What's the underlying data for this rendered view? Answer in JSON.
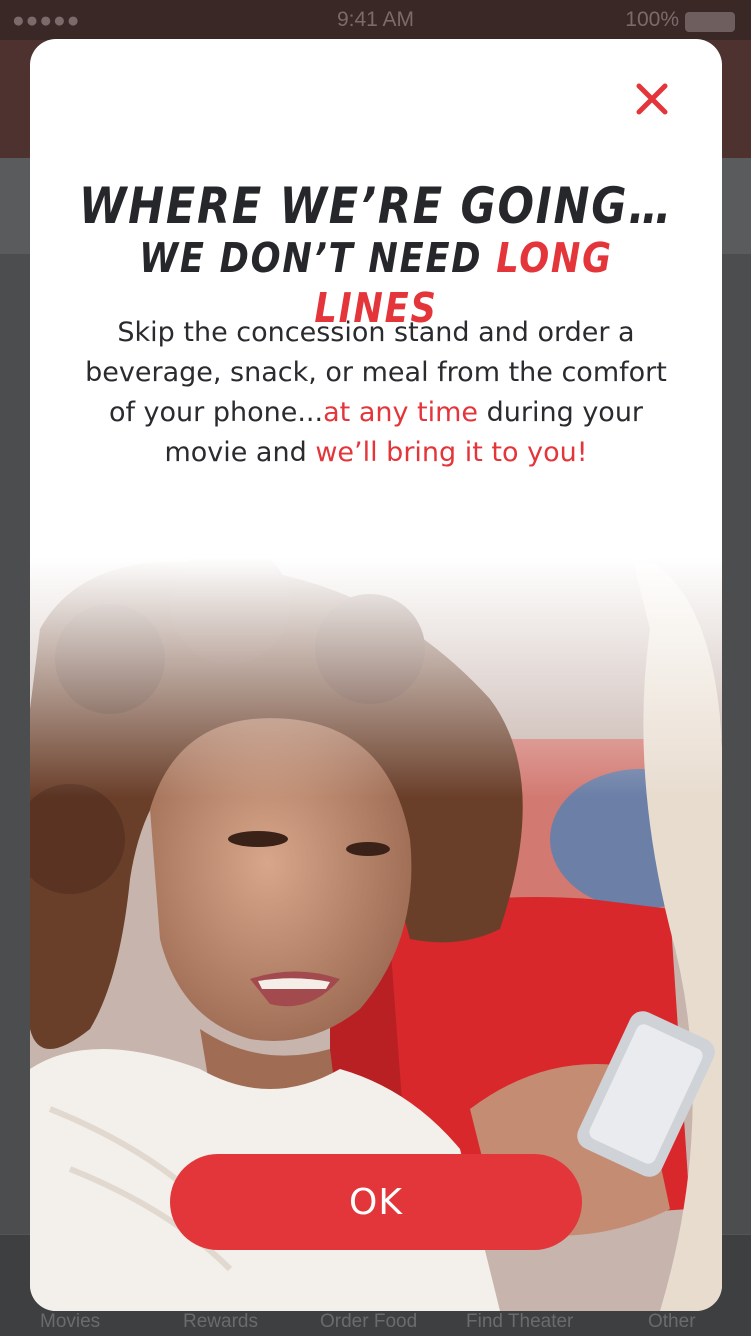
{
  "status_bar": {
    "signal": "●●●●●",
    "time": "9:41 AM",
    "battery": "100%"
  },
  "tab_bar": {
    "items": [
      "Movies",
      "Rewards",
      "Order Food",
      "Find Theater",
      "Other"
    ]
  },
  "modal": {
    "close_icon": "close-icon",
    "headline_line1": "WHERE WE’RE GOING…",
    "headline_line2_prefix": "WE DON’T NEED ",
    "headline_line2_accent": "LONG LINES",
    "body": {
      "part1": "Skip the concession stand and order a beverage, snack, or meal from the comfort of your phone...",
      "accent1": "at any time",
      "part2": " during your movie and ",
      "accent2": "we’ll bring it to you!"
    },
    "ok_label": "OK"
  },
  "colors": {
    "accent": "#e3353a",
    "heading": "#25272b",
    "header_bg": "#4e3230"
  }
}
